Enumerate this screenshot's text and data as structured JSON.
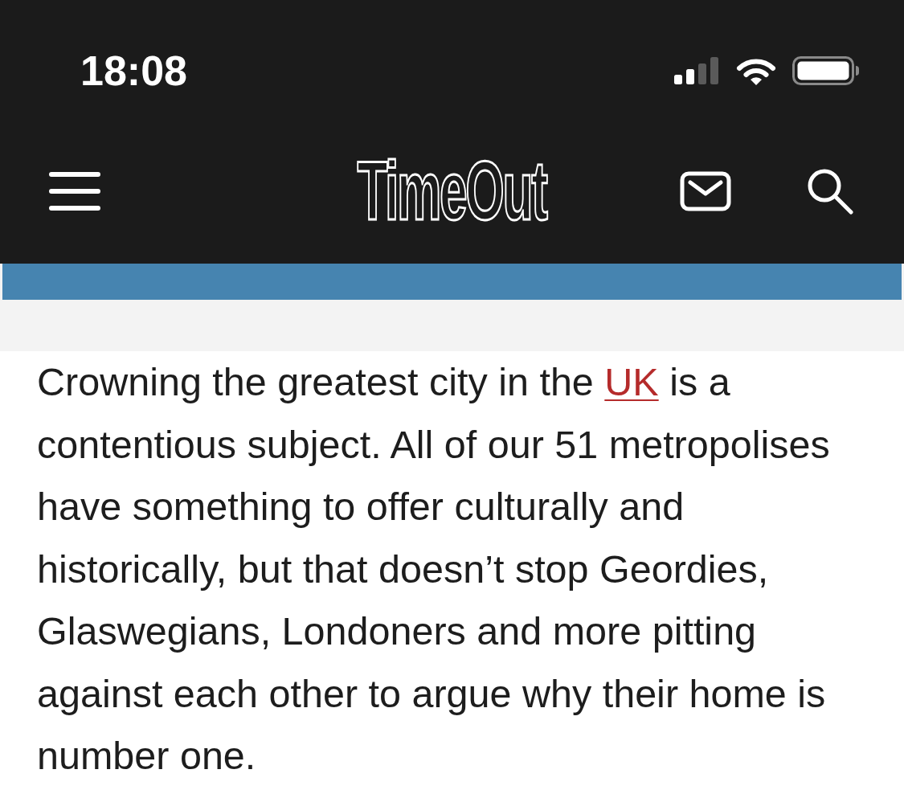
{
  "status_bar": {
    "time": "18:08"
  },
  "header": {
    "logo": "TimeOut"
  },
  "article": {
    "paragraph": [
      {
        "kind": "text",
        "text": "Crowning the greatest city in the "
      },
      {
        "kind": "link",
        "text": "UK"
      },
      {
        "kind": "text",
        "text": " is a contentious subject. All of our 51 metropolises have something to offer culturally and historically, but that doesn’t stop Geordies, Glaswegians, Londoners and more pitting against each other to argue why their home is number one."
      }
    ]
  }
}
